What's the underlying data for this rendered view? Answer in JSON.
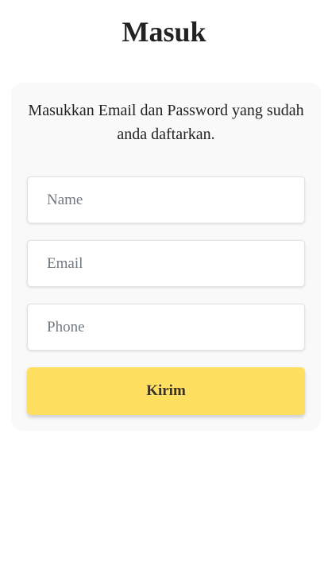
{
  "page": {
    "title": "Masuk"
  },
  "form": {
    "subtitle": "Masukkan Email dan Password yang sudah anda daftarkan.",
    "name_placeholder": "Name",
    "email_placeholder": "Email",
    "phone_placeholder": "Phone",
    "submit_label": "Kirim"
  },
  "colors": {
    "accent": "#ffdf60",
    "card_background": "#f9f9f9",
    "text": "#222222"
  }
}
